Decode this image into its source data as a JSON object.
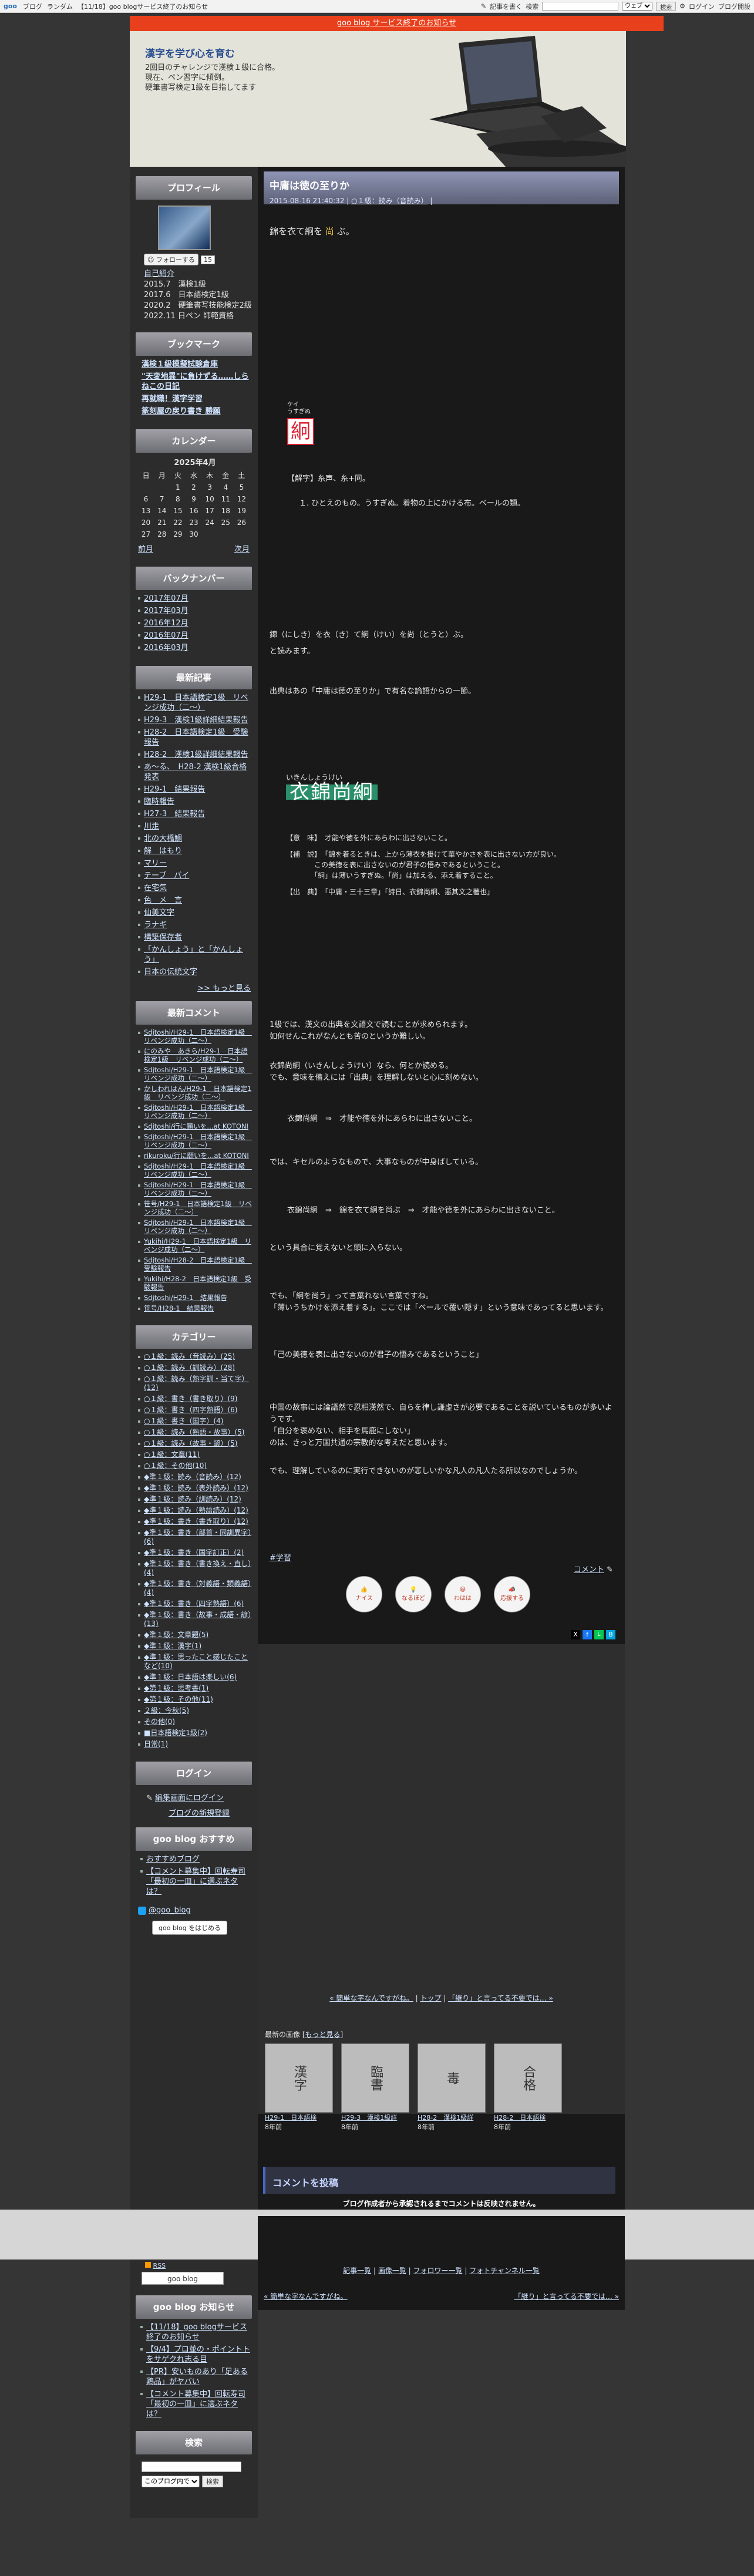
{
  "topbar": {
    "logo": "goo",
    "links": [
      "ブログ",
      "ランダム",
      "【11/18】goo blogサービス終了のお知らせ"
    ],
    "write": "記事を書く",
    "search_label": "検索",
    "search_placeholder": "",
    "search_scope": "ウェブ",
    "search_btn": "検索",
    "login": "ログイン",
    "help": "ブログ開設"
  },
  "notice": {
    "text": "goo blog サービス終了のお知らせ"
  },
  "header": {
    "title": "漢字を学び心を育む",
    "description": "2回目のチャレンジで漢検１級に合格。\n現在、ペン習字に傾倒。\n硬筆書写検定1級を目指してます"
  },
  "sidebar": {
    "profile": {
      "title": "プロフィール",
      "follow": "フォローする",
      "follow_count": "15",
      "intro_link": "自己紹介",
      "items": [
        "2015.7　漢検1級",
        "2017.6　日本語検定1級",
        "2020.2　硬筆書写技能検定2級",
        "2022.11 日ペン 師範資格"
      ]
    },
    "bookmark": {
      "title": "ブックマーク",
      "items": [
        "漢検１級模擬試験倉庫",
        "\"天変地異\"に負けずる……しらねこの日記",
        "再就職！漢字学習",
        "篆刻屋の戻り書き 勝願"
      ]
    },
    "calendar": {
      "title": "カレンダー",
      "month": "2025年4月",
      "weekdays": [
        "日",
        "月",
        "火",
        "水",
        "木",
        "金",
        "土"
      ],
      "rows": [
        [
          "",
          "",
          "1",
          "2",
          "3",
          "4",
          "5"
        ],
        [
          "6",
          "7",
          "8",
          "9",
          "10",
          "11",
          "12"
        ],
        [
          "13",
          "14",
          "15",
          "16",
          "17",
          "18",
          "19"
        ],
        [
          "20",
          "21",
          "22",
          "23",
          "24",
          "25",
          "26"
        ],
        [
          "27",
          "28",
          "29",
          "30",
          "",
          "",
          ""
        ]
      ],
      "prev": "前月",
      "next": "次月"
    },
    "backnumber": {
      "title": "バックナンバー",
      "items": [
        "2017年07月",
        "2017年03月",
        "2016年12月",
        "2016年07月",
        "2016年03月"
      ]
    },
    "recent": {
      "title": "最新記事",
      "items": [
        "H29-1　日本語検定1級　リベンジ成功（二〜）",
        "H29-3　漢検1級詳細結果報告",
        "H28-2　日本語検定1級　受験報告",
        "H28-2　漢検1級詳細結果報告",
        "あ〜る、　H28-2 漢検1級合格発表",
        "H29-1　結果報告",
        "臨時報告",
        "H27-3　結果報告",
        "川走",
        "北の大橋鯛",
        "解　はもり",
        "マリー",
        "テーブ　バイ",
        "在宅気",
        "色　メ　言",
        "仙美文字",
        "ラナギ",
        "構築保存者",
        "「かんしょう」と「かんしょう」",
        "日本の伝統文字"
      ],
      "more": ">> もっと見る"
    },
    "comments": {
      "title": "最新コメント",
      "items": [
        "Sdjtoshi/H29-1　日本語検定1級　リベンジ成功（二〜）",
        "にのみや　あきら/H29-1　日本語検定1級　リベンジ成功（二〜）",
        "Sdjtoshi/H29-1　日本語検定1級　リベンジ成功（二〜）",
        "かしわれはん/H29-1　日本語検定1級　リベンジ成功（二〜）",
        "Sdjtoshi/H29-1　日本語検定1級　リベンジ成功（二〜）",
        "Sdjtoshi/行に願いを…at KOTONI",
        "Sdjtoshi/H29-1　日本語検定1級　リベンジ成功（二〜）",
        "rikuroku/行に願いを…at KOTONI",
        "Sdjtoshi/H29-1　日本語検定1級　リベンジ成功（二〜）",
        "Sdjtoshi/H29-1　日本語検定1級　リベンジ成功（二〜）",
        "笹号/H29-1　日本語検定1級　リベンジ成功（二〜）",
        "Sdjtoshi/H29-1　日本語検定1級　リベンジ成功（二〜）",
        "Yukihi/H29-1　日本語検定1級　リベンジ成功（二〜）",
        "Sdjtoshi/H28-2　日本語検定1級　受験報告",
        "Yukihi/H28-2　日本語検定1級　受験報告",
        "Sdjtoshi/H29-1　結果報告",
        "笹号/H28-1　結果報告"
      ]
    },
    "category": {
      "title": "カテゴリー",
      "items": [
        "○１級：読み（音読み）(25)",
        "○１級：読み（訓読み）(28)",
        "○１級：読み（熟字訓・当て字）(12)",
        "○１級：書き（書き取り）(9)",
        "○１級：書き（四字熟語）(6)",
        "○１級：書き（国字）(4)",
        "○１級：読み（熟語・故事）(5)",
        "○１級：読み（故事・諺）(5)",
        "○１級：文章(11)",
        "○１級：その他(10)",
        "◆準１級：読み（音読み）(12)",
        "◆準１級：読み（表外読み）(12)",
        "◆準１級：読み（訓読み）(12)",
        "◆準１級：読み（熟語読み）(12)",
        "◆準１級：書き（書き取り）(12)",
        "◆準１級：書き（部首・同訓異字）(6)",
        "◆準１級：書き（国字訂正）(2)",
        "◆準１級：書き（書き換え・直し）(4)",
        "◆準１級：書き（対義語・類義語）(4)",
        "◆準１級：書き（四字熟語）(6)",
        "◆準１級：書き（故事・成語・諺）(13)",
        "◆準１級：文章題(5)",
        "◆準１級：漢字(1)",
        "◆準１級：思ったこと感じたことなど(10)",
        "◆準１級：日本語は楽しい(6)",
        "◆第１級：思考書(1)",
        "◆第１級：その他(11)",
        "２級：今秋(5)",
        "その他(0)",
        "■日本語検定1級(2)",
        "日常(1)"
      ]
    },
    "login": {
      "title": "ログイン",
      "edit": "編集画面にログイン",
      "new": "ブログの新規登録"
    },
    "osusume": {
      "title": "goo blog おすすめ",
      "items": [
        "おすすめブログ",
        "【コメント募集中】回転寿司「最初の一皿」に選ぶネタは？"
      ]
    },
    "gooblog": {
      "handle": "@goo_blog",
      "start": "goo blog をはじめる",
      "rss": "RSS"
    },
    "notice": {
      "title": "goo blog お知らせ",
      "items": [
        "【11/18】goo blogサービス終了のお知らせ",
        "【9/4】プロ並の・ポイントトをサゲクれ志る目",
        "【PR】安いものあり「足ある鶏品」がヤバい",
        "【コメント募集中】回転寿司「最初の一皿」に選ぶネタは？"
      ]
    },
    "search": {
      "title": "検索",
      "scope": "このブログ内で",
      "btn": "検索"
    }
  },
  "post": {
    "title": "中庸は徳の至りか",
    "meta_date": "2015-08-16 21:40:32",
    "meta_cat": "○１級：読み（音読み）",
    "lead_before": "錦を衣て絅を",
    "lead_hl": "尚",
    "lead_after": "ぶ。",
    "kanji_reading_top": "ケイ",
    "kanji_reading": "うすぎぬ",
    "kanji_char": "絅",
    "kaiji": "【解字】糸声、糸+冋。",
    "meaning": "１. ひとえのもの。うすぎぬ。着物の上にかける布。ベールの類。",
    "reading_sentence": "錦（にしき）を衣（き）て絅（けい）を尚（とうと）ぶ。",
    "yomu": "と読みます。",
    "source": "出典はあの「中庸は徳の至りか」で有名な論語からの一節。",
    "idiom_reading": "いきんしょうけい",
    "idiom": "衣錦尚絅",
    "def_label1": "【意　味】",
    "def_text1": "才能や徳を外にあらわに出さないこと。",
    "def_label2": "【補　説】",
    "def_text2": "「錦を着るときは、上から薄衣を掛けて華やかさを表に出さない方が良い。\n　　　　この美徳を表に出さないのが君子の悟みであるということ。\n　　　　「絅」は薄いうすぎぬ。「尚」は加える、添え着すること。",
    "def_label3": "【出　典】",
    "def_text3": "「中庸・三十三章」「詩日、衣錦尚絅、悪其文之著也」",
    "p1": "1級では、漢文の出典を文語文で読むことが求められます。\n如何せんこれがなんとも苦のというか難しい。",
    "p2": "衣錦尚絅（いきんしょうけい）なら、何とか読める。\nでも、意味を備えには「出典」を理解しないと心に刻めない。",
    "p3": "衣錦尚絅　⇒　才能や徳を外にあらわに出さないこと。",
    "p4": "では、キセルのようなもので、大事なものが中身ばしている。",
    "p5": "衣錦尚絅　⇒　錦を衣て絅を尚ぶ　⇒　才能や徳を外にあらわに出さないこと。",
    "p6": "という具合に覚えないと頭に入らない。",
    "p7": "でも、「絅を尚う」って言葉れない言葉ですね。\n「薄いうちかけを添え着する」。ここでは「ベールで覆い隠す」という意味であってると思います。",
    "p8": "「己の美徳を表に出さないのが君子の悟みであるということ」",
    "p9": "中国の故事には論語然で忍相漢然で、自らを律し謙虚さが必要であることを説いているものが多いようです。\n「自分を褒めない、相手を馬鹿にしない」\nのは、きっと万国共通の宗教的な考えだと思います。",
    "p10": "でも、理解しているのに実行できないのが悲しいかな凡人の凡人たる所以なのでしょうか。",
    "tag": "#学習",
    "comment_link": "コメント",
    "reactions": [
      "ナイス",
      "なるほど",
      "わはは",
      "応援する"
    ],
    "nav_prev": "« 簡単な字なんですがね。",
    "nav_top": "トップ",
    "nav_next": "「継り」と言ってる不要では… »",
    "recent_images_title": "最新の画像",
    "recent_images_more": "もっと見る",
    "recent_images": [
      {
        "label": "H29-1　日本語検",
        "age": "8年前",
        "glyph": "漢字"
      },
      {
        "label": "H29-3　漢検1級詳",
        "age": "8年前",
        "glyph": "臨書"
      },
      {
        "label": "H28-2　漢検1級詳",
        "age": "8年前",
        "glyph": "毒"
      },
      {
        "label": "H28-2　日本語検",
        "age": "8年前",
        "glyph": "合格"
      }
    ],
    "comment_form_title": "コメントを投稿",
    "comment_notice": "ブログ作成者から承認されるまでコメントは反映されません。",
    "footer_links": [
      "記事一覧",
      "画像一覧",
      "フォロワー一覧",
      "フォトチャンネル一覧"
    ],
    "footer_prev": "« 簡単な字なんですがね。",
    "footer_next": "「継り」と言ってる不要では… »"
  },
  "colors": {
    "accent_red": "#e8401c",
    "header_blue": "#284d8f",
    "idiom_green": "#2a8f6a"
  }
}
